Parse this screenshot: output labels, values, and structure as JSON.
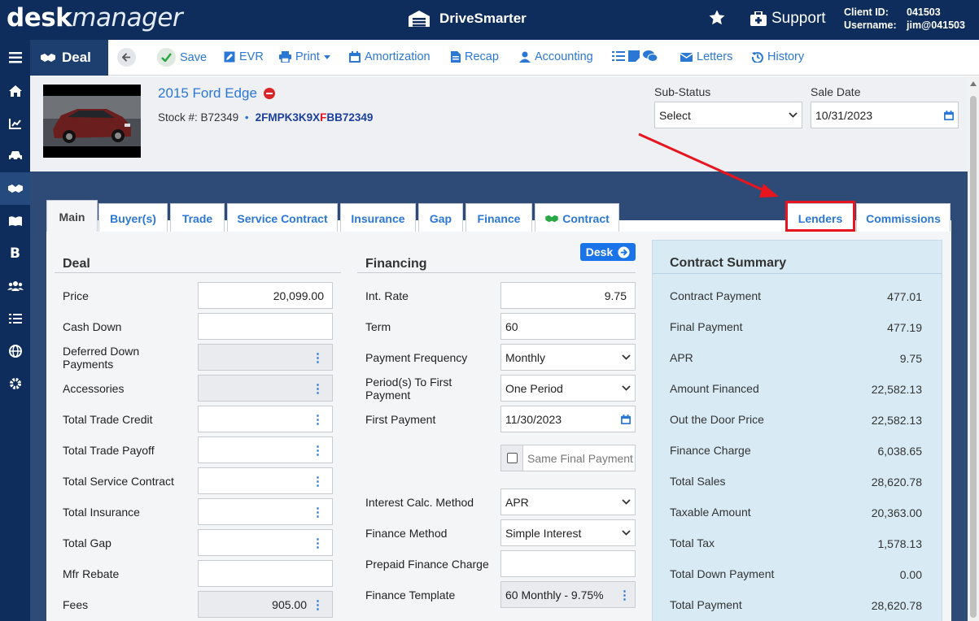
{
  "header": {
    "logo_bold": "desk",
    "logo_italic": "manager",
    "brand": "DriveSmarter",
    "support": "Support",
    "client_label": "Client ID:",
    "client_value": "041503",
    "username_label": "Username:",
    "username_value": "jim@041503"
  },
  "toolbar": {
    "section": "Deal",
    "save": "Save",
    "evr": "EVR",
    "print": "Print",
    "amortization": "Amortization",
    "recap": "Recap",
    "accounting": "Accounting",
    "letters": "Letters",
    "history": "History"
  },
  "vehicle": {
    "title": "2015 Ford Edge",
    "stock_label": "Stock #:",
    "stock": "B72349",
    "vin_pre": "2FMPK3K9X",
    "vin_mark": "F",
    "vin_post": "BB72349",
    "substatus_label": "Sub-Status",
    "substatus_value": "Select",
    "sale_date_label": "Sale Date",
    "sale_date_value": "10/31/2023"
  },
  "tabs": {
    "main": "Main",
    "buyers": "Buyer(s)",
    "trade": "Trade",
    "service_contract": "Service Contract",
    "insurance": "Insurance",
    "gap": "Gap",
    "finance": "Finance",
    "contract": "Contract",
    "lenders": "Lenders",
    "commissions": "Commissions"
  },
  "deal": {
    "title": "Deal",
    "price_label": "Price",
    "price": "20,099.00",
    "cash_down_label": "Cash Down",
    "deferred_label": "Deferred Down Payments",
    "accessories_label": "Accessories",
    "trade_credit_label": "Total Trade Credit",
    "trade_payoff_label": "Total Trade Payoff",
    "service_label": "Total Service Contract",
    "insurance_label": "Total Insurance",
    "gap_label": "Total Gap",
    "rebate_label": "Mfr Rebate",
    "fees_label": "Fees",
    "fees": "905.00"
  },
  "financing": {
    "title": "Financing",
    "desk_button": "Desk",
    "rate_label": "Int. Rate",
    "rate": "9.75",
    "term_label": "Term",
    "term": "60",
    "freq_label": "Payment Frequency",
    "freq": "Monthly",
    "periods_label": "Period(s) To First Payment",
    "periods": "One Period",
    "first_payment_label": "First Payment",
    "first_payment": "11/30/2023",
    "same_final": "Same Final Payment",
    "calc_label": "Interest Calc. Method",
    "calc": "APR",
    "method_label": "Finance Method",
    "method": "Simple Interest",
    "prepaid_label": "Prepaid Finance Charge",
    "template_label": "Finance Template",
    "template": "60 Monthly - 9.75%"
  },
  "summary": {
    "title": "Contract Summary",
    "rows": [
      {
        "label": "Contract Payment",
        "value": "477.01"
      },
      {
        "label": "Final Payment",
        "value": "477.19"
      },
      {
        "label": "APR",
        "value": "9.75"
      },
      {
        "label": "Amount Financed",
        "value": "22,582.13"
      },
      {
        "label": "Out the Door Price",
        "value": "22,582.13"
      },
      {
        "label": "Finance Charge",
        "value": "6,038.65"
      },
      {
        "label": "Total Sales",
        "value": "28,620.78"
      },
      {
        "label": "Taxable Amount",
        "value": "20,363.00"
      },
      {
        "label": "Total Tax",
        "value": "1,578.13"
      },
      {
        "label": "Total Down Payment",
        "value": "0.00"
      },
      {
        "label": "Total Payment",
        "value": "28,620.78"
      }
    ]
  },
  "colors": {
    "nav": "#0e2d5c",
    "accent": "#2b77d4",
    "highlight": "#e8141e",
    "summary_bg": "#d8ebf5"
  }
}
